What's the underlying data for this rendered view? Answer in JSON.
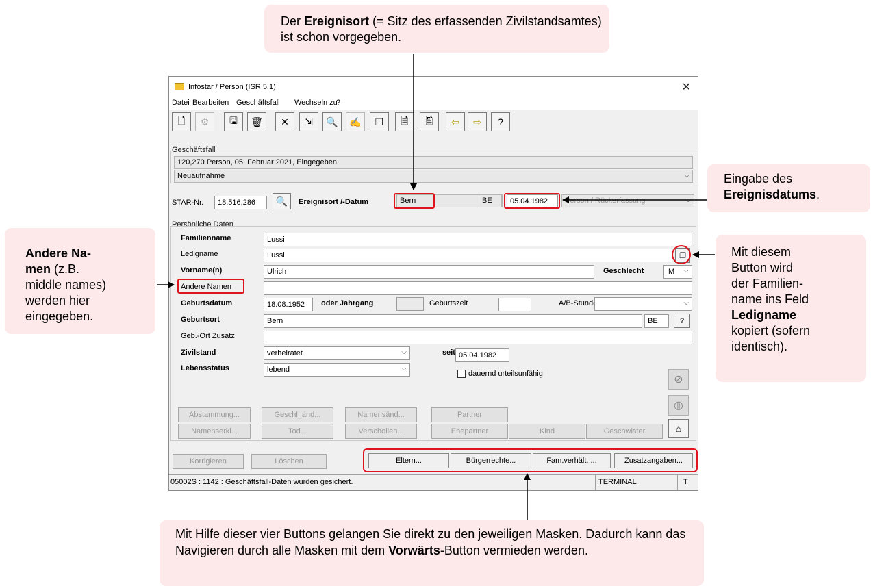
{
  "callouts": {
    "top": {
      "pre": "Der ",
      "bold": "Ereignisort",
      "post": " (= Sitz des erfassenden Zivilstandsamtes) ist schon vorgegeben."
    },
    "right_top": {
      "pre": "Eingabe des ",
      "bold": "Ereignisdatums",
      "post": "."
    },
    "left": {
      "bold": "Andere Na-men",
      "post": " (z.B. middle names) werden hier eingegeben."
    },
    "right": {
      "pre": "Mit diesem Button wird der Familien-name ins Feld ",
      "bold": "Ledigname",
      "post": " kopiert (sofern identisch)."
    },
    "bottom": {
      "pre": "Mit Hilfe dieser vier Buttons gelangen Sie direkt zu den jeweiligen Masken. Dadurch kann das Navigieren durch alle Masken mit dem ",
      "bold": "Vorwärts",
      "post": "-Button vermieden werden."
    }
  },
  "window": {
    "title": "Infostar / Person (ISR 5.1)",
    "menu": [
      "Datei",
      "Bearbeiten",
      "Geschäftsfall",
      "Wechseln zu",
      "?"
    ],
    "toolbar_icons": [
      "new-icon",
      "gear-icon",
      "save-icon",
      "trash-icon",
      "cancel-icon",
      "import-icon",
      "binoculars-icon",
      "sign-icon",
      "copy-icon",
      "document-icon",
      "preview-icon",
      "back-arrow-icon",
      "forward-arrow-icon",
      "help-icon"
    ],
    "geschaeftsfall": {
      "label": "Geschäftsfall",
      "line1": "120,270  Person, 05. Februar 2021, Eingegeben",
      "line2": "Neuaufnahme"
    },
    "star": {
      "label": "STAR-Nr.",
      "value": "18,516,286",
      "ereignis_label": "Ereignisort /-Datum",
      "ort": "Bern",
      "kanton": "BE",
      "datum": "05.04.1982",
      "typ": "Person / Rückerfassung"
    },
    "personal": {
      "group_label": "Persönliche Daten",
      "familienname_label": "Familienname",
      "familienname": "Lussi",
      "ledigname_label": "Ledigname",
      "ledigname": "Lussi",
      "vorname_label": "Vorname(n)",
      "vorname": "Ulrich",
      "geschlecht_label": "Geschlecht",
      "geschlecht": "M",
      "andere_label": "Andere Namen",
      "andere": "",
      "geburtsdatum_label": "Geburtsdatum",
      "geburtsdatum": "18.08.1952",
      "jahrgang_label": "oder Jahrgang",
      "geburtszeit_label": "Geburtszeit",
      "ab_label": "A/B-Stunde",
      "geburtsort_label": "Geburtsort",
      "geburtsort": "Bern",
      "geburtsort_kanton": "BE",
      "help": "?",
      "zusatz_label": "Geb.-Ort Zusatz",
      "zivilstand_label": "Zivilstand",
      "zivilstand": "verheiratet",
      "seit_label": "seit",
      "seit": "05.04.1982",
      "lebensstatus_label": "Lebensstatus",
      "lebensstatus": "lebend",
      "urteil_label": "dauernd urteilsunfähig"
    },
    "buttons_row1": [
      "Abstammung...",
      "Geschl_änd...",
      "Namensänd...",
      "Partner"
    ],
    "buttons_row2": [
      "Namenserkl...",
      "Tod...",
      "Verschollen...",
      "Ehepartner",
      "Kind",
      "Geschwister"
    ],
    "buttons_row3": [
      "Korrigieren",
      "Löschen"
    ],
    "nav_buttons": [
      "Eltern...",
      "Bürgerrechte...",
      "Fam.verhält. ...",
      "Zusatzangaben..."
    ],
    "status": {
      "message": "05002S : 1142 : Geschäftsfall-Daten wurden gesichert.",
      "terminal": "TERMINAL",
      "flag": "T"
    }
  }
}
